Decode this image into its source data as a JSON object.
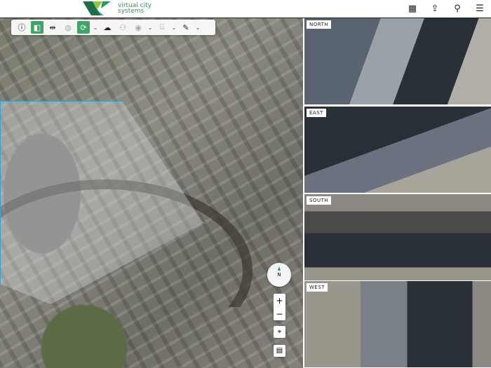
{
  "header": {
    "logo_line1": "virtual city",
    "logo_line2": "systems",
    "brand_color": "#2a9a5a"
  },
  "toolbar": {
    "items": [
      "info-icon",
      "split-view-icon",
      "swipe-icon",
      "globe-icon",
      "rotate-icon",
      "upload-icon",
      "transparency-icon",
      "view-icon",
      "clipping-icon",
      "draw-icon"
    ]
  },
  "views": {
    "north": "NORTH",
    "east": "EAST",
    "south": "SOUTH",
    "west": "WEST"
  },
  "map": {
    "compass_label": "N",
    "zoom_in": "+",
    "zoom_out": "−"
  }
}
